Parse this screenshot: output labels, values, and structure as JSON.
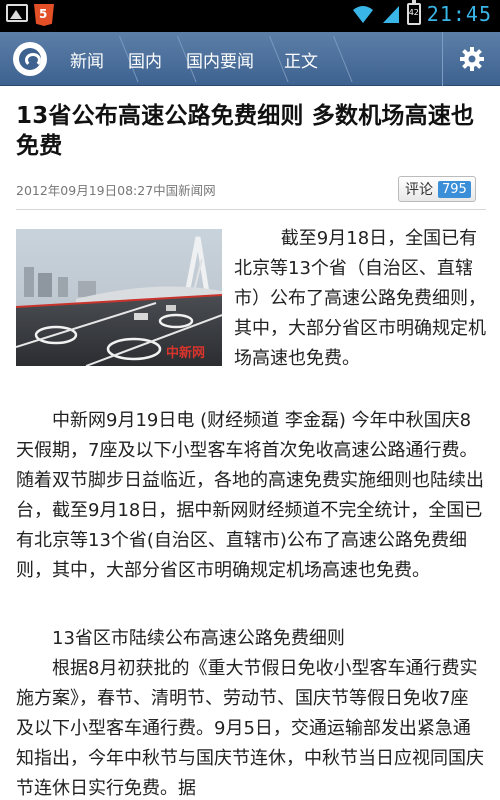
{
  "status_bar": {
    "time": "21:45",
    "battery_level": "42"
  },
  "navbar": {
    "breadcrumbs": [
      "新闻",
      "国内",
      "国内要闻",
      "正文"
    ]
  },
  "article": {
    "title": "13省公布高速公路免费细则 多数机场高速也免费",
    "meta": "2012年09月19日08:27中国新闻网",
    "comment_label": "评论",
    "comment_count": "795",
    "photo_caption_watermark": "中新网",
    "paragraphs": [
      "截至9月18日，全国已有北京等13个省（自治区、直辖市）公布了高速公路免费细则，其中，大部分省区市明确规定机场高速也免费。",
      "中新网9月19日电 (财经频道 李金磊) 今年中秋国庆8天假期，7座及以下小型客车将首次免收高速公路通行费。随着双节脚步日益临近，各地的高速免费实施细则也陆续出台，截至9月18日，据中新网财经频道不完全统计，全国已有北京等13个省(自治区、直辖市)公布了高速公路免费细则，其中，大部分省区市明确规定机场高速也免费。",
      "13省区市陆续公布高速公路免费细则",
      "根据8月初获批的《重大节假日免收小型客车通行费实施方案》，春节、清明节、劳动节、国庆节等假日免收7座及以下小型客车通行费。9月5日，交通运输部发出紧急通知指出，今年中秋节与国庆节连休，中秋节当日应视同国庆节连休日实行免费。据"
    ]
  },
  "colors": {
    "navbar": "#4a6e9a",
    "accent": "#3b8fd8",
    "status_time": "#39b5e8"
  }
}
